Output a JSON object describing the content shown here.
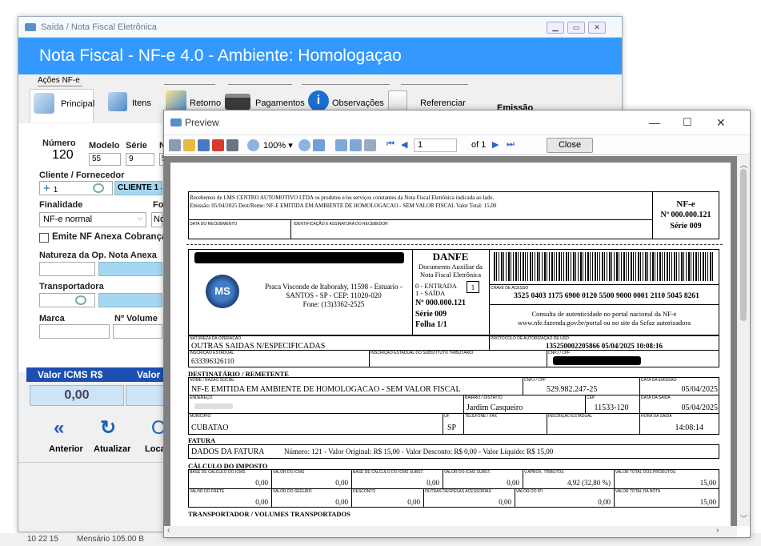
{
  "bg_window": {
    "title": "Saída / Nota Fiscal Eletrônica",
    "header": "Nota Fiscal  - NF-e 4.0 - Ambiente: Homologaçao",
    "acoes_label": "Ações NF-e",
    "tabs": [
      "Principal",
      "Itens",
      "Retorno",
      "Pagamentos",
      "Observações",
      "Referenciar"
    ],
    "emissao_label": "Emissão",
    "numero_label": "Número",
    "numero_value": "120",
    "modelo_label": "Modelo",
    "modelo_value": "55",
    "serie_label": "Série",
    "serie_value": "9",
    "col_n": "N",
    "col_five": "5",
    "cliente_label": "Cliente / Fornecedor",
    "cliente_count": "1",
    "cliente_value": "CLIENTE 1 JO",
    "finalidade_label": "Finalidade",
    "finalidade_value": "NF-e normal",
    "for_label": "For",
    "for_value": "No",
    "anexa_label": "Emite NF Anexa Cobrança",
    "natureza_label": "Natureza da Op. Nota Anexa",
    "transportadora_label": "Transportadora",
    "marca_label": "Marca",
    "volume_label": "Nº Volume",
    "icms_label": "Valor ICMS R$",
    "valor_label": "Valor I",
    "icms_value": "0,00",
    "nav_anterior": "Anterior",
    "nav_atualizar": "Atualizar",
    "nav_local": "Local",
    "status_left": "10 22 15",
    "status_mid": "Mensário 105.00 B"
  },
  "preview": {
    "title": "Preview",
    "zoom": "100%",
    "page": "1",
    "of": "of 1",
    "close": "Close"
  },
  "danfe": {
    "receipt_text": "Recebemos de LMS CENTRO AUTOMOTIVO LTDA os produtos e/ou serviços constantes da Nota Fiscal Eletrônica indicada ao lado.",
    "receipt_text2": "Emissão: 05/04/2025 Dest/Reme: NF-E EMITIDA EM AMBIENTE DE HOMOLOGACAO - SEM VALOR FISCAL Valor Total: 15,00",
    "data_receb_label": "DATA DO RECEBIMENTO",
    "ident_label": "IDENTIFICAÇÃO E ASSINATURA DO RECEBEDOR",
    "nfe_label": "NF-e",
    "nfe_number": "Nº 000.000.121",
    "nfe_serie": "Série 009",
    "logo_text": "MS",
    "address1": "Praca Visconde de Itaborahy, 11598 - Estuario -",
    "address2": "SANTOS - SP - CEP: 11020-020",
    "address3": "Fone: (13)3362-2525",
    "danfe_title": "DANFE",
    "danfe_sub1": "Documento Auxiliar da",
    "danfe_sub2": "Nota Fiscal Eletrônica",
    "entrada": "0 - ENTRADA",
    "saida": "1 - SAÍDA",
    "tipo": "1",
    "danfe_num": "Nº 000.000.121",
    "danfe_serie": "Série 009",
    "folha": "Folha 1/1",
    "chave_label": "CHAVE DE ACESSO",
    "chave": "3525 0403 1175 6900 0120 5500 9000 0001 2110 5045 8261",
    "consulta1": "Consulta de autenticidade no portal nacional da NF-e",
    "consulta2": "www.nfe.fazenda.gov.br/portal ou no site da Sefaz autorizadora",
    "natureza_label": "NATUREZA DA OPERAÇÃO",
    "natureza": "OUTRAS SAIDAS N/ESPECIFICADAS",
    "protocolo_label": "PROTOCOLO DE AUTORIZAÇÃO DE USO",
    "protocolo": "135250002205866 05/04/2025 10:08:16",
    "ie_label": "INSCRIÇÃO ESTADUAL",
    "ie": "633396326110",
    "ie_sub_label": "INSCRIÇÃO ESTADUAL DO SUBSTITUTO TRIBUTÁRIO",
    "cnpj_label": "CNPJ / CPF",
    "dest_header": "DESTINATÁRIO / REMETENTE",
    "nome_label": "NOME / RAZÃO SOCIAL",
    "nome": "NF-E EMITIDA EM AMBIENTE DE HOMOLOGACAO - SEM VALOR FISCAL",
    "dest_cnpj_label": "CNPJ / CPF",
    "dest_cnpj": "529.982.247-25",
    "emissao_label": "DATA DA EMISSÃO",
    "emissao": "05/04/2025",
    "endereco_label": "ENDEREÇO",
    "bairro_label": "BAIRRO / DISTRITO",
    "bairro": "Jardim Casqueiro",
    "cep_label": "CEP",
    "cep": "11533-120",
    "saida_label": "DATA DA SAÍDA",
    "saida_date": "05/04/2025",
    "municipio_label": "MUNICÍPIO",
    "municipio": "CUBATAO",
    "uf_label": "UF",
    "uf": "SP",
    "fone_label": "TELEFONE / FAX",
    "ie_dest_label": "INSCRIÇÃO ESTADUAL",
    "hora_label": "HORA DA SAÍDA",
    "hora": "14:08:14",
    "fatura_header": "FATURA",
    "fatura_line1": "DADOS DA FATURA",
    "fatura_line2": "Número:  121   -  Valor Original: R$ 15,00   -  Valor Desconto:  R$ 0,00   -  Valor Líquido: R$ 15,00",
    "calc_header": "CÁLCULO DO IMPOSTO",
    "calc_row1": [
      {
        "label": "BASE DE CÁLCULO DO ICMS",
        "value": "0,00"
      },
      {
        "label": "VALOR DO ICMS",
        "value": "0,00"
      },
      {
        "label": "BASE DE CÁLCULO DO ICMS SUBST.",
        "value": "0,00"
      },
      {
        "label": "VALOR DO ICMS SUBST.",
        "value": "0,00"
      },
      {
        "label": "V.APROX. TRIBUTOS",
        "value": "4,92 (32,80 %)"
      },
      {
        "label": "VALOR TOTAL DOS PRODUTOS",
        "value": "15,00"
      }
    ],
    "calc_row2": [
      {
        "label": "VALOR DO FRETE",
        "value": "0,00"
      },
      {
        "label": "VALOR DO SEGURO",
        "value": "0,00"
      },
      {
        "label": "DESCONTO",
        "value": "0,00"
      },
      {
        "label": "OUTRAS DESPESAS ACESSÓRIAS",
        "value": "0,00"
      },
      {
        "label": "VALOR DO IPI",
        "value": "0,00"
      },
      {
        "label": "VALOR TOTAL DA NOTA",
        "value": "15,00"
      }
    ],
    "transp_header": "TRANSPORTADOR / VOLUMES TRANSPORTADOS"
  }
}
